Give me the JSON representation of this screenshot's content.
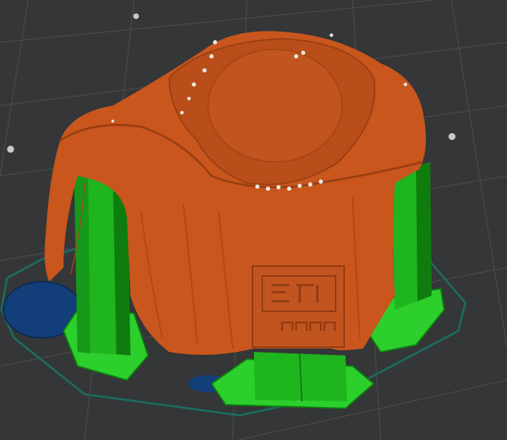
{
  "viewport": {
    "name": "3d-print-preview",
    "colors": {
      "background": "#343638",
      "grid": "#4a4c4e",
      "grid_marker": "#c8c8c8",
      "perimeter": "#c8561d",
      "perimeter_dark": "#9a3f12",
      "support": "#1fb51f",
      "support_dark": "#0e7d0e",
      "skirt": "#1d6b5e",
      "brim_blue": "#123f7a",
      "highlight": "#e8e8e0"
    }
  }
}
